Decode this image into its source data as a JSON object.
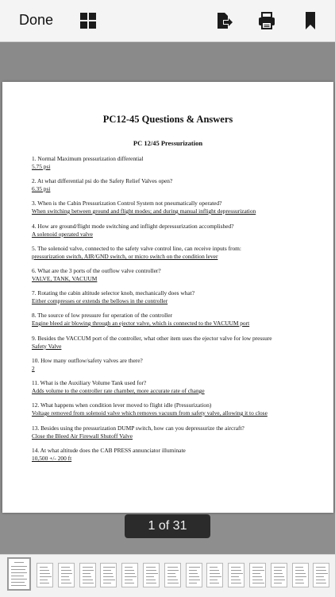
{
  "toolbar": {
    "done_label": "Done",
    "icons": [
      "grid-icon",
      "export-icon",
      "print-icon",
      "bookmark-icon"
    ]
  },
  "document": {
    "title": "PC12-45 Questions & Answers",
    "subtitle": "PC 12/45 Pressurization",
    "items": [
      {
        "q": "1. Normal Maximum pressurization differential",
        "a": "5.75 psi"
      },
      {
        "q": "2. At what differential psi do the Safety Relief Valves open?",
        "a": "6.35 psi"
      },
      {
        "q": "3. When is the Cabin Pressurization Control System not pneumatically operated?",
        "a": "When switching between ground and flight modes; and during manual inflight depressurization"
      },
      {
        "q": "4. How are ground/flight mode switching and inflight depressurization accomplished?",
        "a": "A solenoid operated valve"
      },
      {
        "q": "5. The solenoid valve, connected to the safety valve control line, can receive inputs from:",
        "a": "pressurization switch, AIR/GND switch, or micro switch on the condition lever"
      },
      {
        "q": "6. What are the 3 ports of the outflow valve controller?",
        "a": "VALVE, TANK, VACUUM"
      },
      {
        "q": "7. Rotating the cabin altitude selector knob, mechanically does what?",
        "a": "Either compresses or extends the bellows in the controller"
      },
      {
        "q": "8. The source of low pressure for operation of the controller",
        "a": "Engine bleed air blowing through an ejector valve, which is connected to the VACUUM port"
      },
      {
        "q": "9. Besides the VACCUM port of the controller, what other item uses the ejector valve for low pressure",
        "a": "Safety Valve"
      },
      {
        "q": "10. How many outflow/safety valves are there?",
        "a": "2"
      },
      {
        "q": "11. What is the Auxiliary Volume Tank used for?",
        "a": "Adds volume to the controller rate chamber, more accurate rate of change"
      },
      {
        "q": "12. What happens when condition lever moved to flight idle (Pressurization)",
        "a": "Voltage removed from solenoid valve which removes vacuum from safety valve, allowing it to close"
      },
      {
        "q": "13. Besides using the pressurization DUMP switch, how can you depressurize the aircraft?",
        "a": "Close the Bleed Air Firewall Shutoff Valve"
      },
      {
        "q": "14. At what altitude does the CAB PRESS annunciator illuminate",
        "a": "10,500 +/- 200 ft"
      }
    ]
  },
  "pager": {
    "indicator": "1 of 31",
    "current_page": 1,
    "total_pages": 31
  },
  "thumbnails": {
    "visible_count": 15
  }
}
